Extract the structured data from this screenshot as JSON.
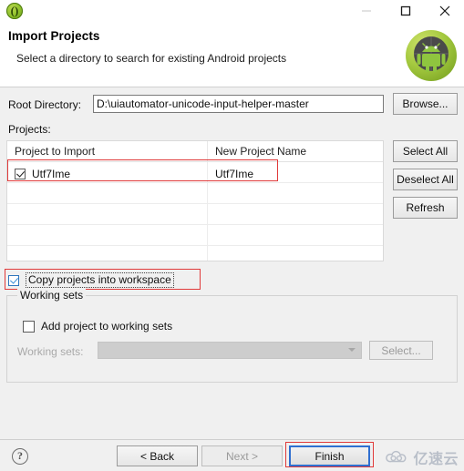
{
  "window": {
    "icon": "eclipse-adt-icon",
    "controls": {
      "minimize": "minimize-icon",
      "maximize": "maximize-icon",
      "close": "close-icon"
    }
  },
  "header": {
    "title": "Import Projects",
    "subtitle": "Select a directory to search for existing Android projects",
    "banner_icon": "android-robot-icon"
  },
  "form": {
    "root_directory_label": "Root Directory:",
    "root_directory_value": "D:\\uiautomator-unicode-input-helper-master",
    "root_directory_placeholder": "",
    "browse_label": "Browse...",
    "projects_label": "Projects:"
  },
  "table": {
    "columns": [
      "Project to Import",
      "New Project Name"
    ],
    "rows": [
      {
        "checked": true,
        "project_to_import": "Utf7Ime",
        "new_project_name": "Utf7Ime"
      },
      {
        "checked": false,
        "project_to_import": "",
        "new_project_name": ""
      },
      {
        "checked": false,
        "project_to_import": "",
        "new_project_name": ""
      },
      {
        "checked": false,
        "project_to_import": "",
        "new_project_name": ""
      },
      {
        "checked": false,
        "project_to_import": "",
        "new_project_name": ""
      }
    ]
  },
  "side_buttons": {
    "select_all": "Select All",
    "deselect_all": "Deselect All",
    "refresh": "Refresh"
  },
  "options": {
    "copy_projects_label": "Copy projects into workspace",
    "copy_projects_checked": true
  },
  "working_sets": {
    "group_label": "Working sets",
    "add_project_label": "Add project to working sets",
    "add_project_checked": false,
    "combo_label": "Working sets:",
    "combo_value": "",
    "select_label": "Select..."
  },
  "footer": {
    "help": "?",
    "back": "< Back",
    "next": "Next >",
    "finish": "Finish",
    "watermark_text": "亿速云",
    "watermark_icon": "cloud-logo-icon"
  },
  "annotations": {
    "highlight_color": "#e03a3a",
    "focus_color": "#2f6fd0"
  }
}
